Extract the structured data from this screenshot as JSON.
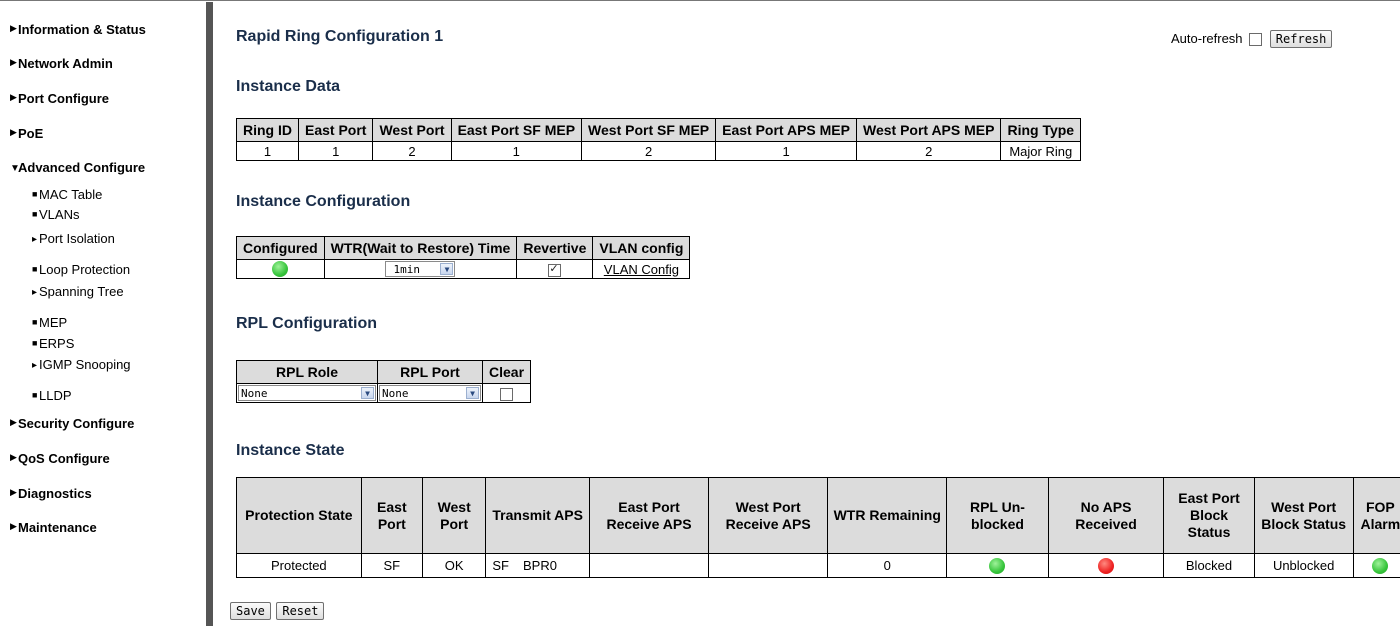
{
  "sidebar": {
    "items": [
      {
        "label": "Information & Status",
        "expanded": false
      },
      {
        "label": "Network Admin",
        "expanded": false
      },
      {
        "label": "Port Configure",
        "expanded": false
      },
      {
        "label": "PoE",
        "expanded": false
      },
      {
        "label": "Advanced Configure",
        "expanded": true
      },
      {
        "label": "Security Configure",
        "expanded": false
      },
      {
        "label": "QoS Configure",
        "expanded": false
      },
      {
        "label": "Diagnostics",
        "expanded": false
      },
      {
        "label": "Maintenance",
        "expanded": false
      }
    ],
    "advanced_children": [
      {
        "label": "MAC Table",
        "type": "leaf"
      },
      {
        "label": "VLANs",
        "type": "leaf"
      },
      {
        "label": "Port Isolation",
        "type": "folder"
      },
      {
        "label": "Loop Protection",
        "type": "leaf"
      },
      {
        "label": "Spanning Tree",
        "type": "folder"
      },
      {
        "label": "MEP",
        "type": "leaf"
      },
      {
        "label": "ERPS",
        "type": "leaf"
      },
      {
        "label": "IGMP Snooping",
        "type": "folder"
      },
      {
        "label": "LLDP",
        "type": "leaf"
      }
    ]
  },
  "page": {
    "title": "Rapid Ring Configuration 1",
    "auto_refresh_label": "Auto-refresh",
    "auto_refresh_checked": false,
    "refresh_button": "Refresh"
  },
  "instance_data": {
    "heading": "Instance Data",
    "headers": [
      "Ring ID",
      "East Port",
      "West Port",
      "East Port SF MEP",
      "West Port SF MEP",
      "East Port APS MEP",
      "West Port APS MEP",
      "Ring Type"
    ],
    "row": [
      "1",
      "1",
      "2",
      "1",
      "2",
      "1",
      "2",
      "Major Ring"
    ]
  },
  "instance_config": {
    "heading": "Instance Configuration",
    "headers": [
      "Configured",
      "WTR(Wait to Restore) Time",
      "Revertive",
      "VLAN config"
    ],
    "configured_status": "green",
    "wtr_value": "1min",
    "revertive_checked": true,
    "vlan_link": "VLAN Config"
  },
  "rpl_config": {
    "heading": "RPL Configuration",
    "headers": [
      "RPL Role",
      "RPL Port",
      "Clear"
    ],
    "rpl_role_value": "None",
    "rpl_port_value": "None",
    "clear_checked": false
  },
  "instance_state": {
    "heading": "Instance State",
    "headers": [
      "Protection State",
      "East Port",
      "West Port",
      "Transmit APS",
      "East Port Receive APS",
      "West Port Receive APS",
      "WTR Remaining",
      "RPL Un-blocked",
      "No APS Received",
      "East Port Block Status",
      "West Port Block Status",
      "FOP Alarm"
    ],
    "row": {
      "protection_state": "Protected",
      "east_port": "SF",
      "west_port": "OK",
      "transmit_aps_a": "SF",
      "transmit_aps_b": "BPR0",
      "east_receive_aps": "",
      "west_receive_aps": "",
      "wtr_remaining": "0",
      "rpl_unblocked": "green",
      "no_aps_received": "red",
      "east_block_status": "Blocked",
      "west_block_status": "Unblocked",
      "fop_alarm": "green"
    }
  },
  "buttons": {
    "save": "Save",
    "reset": "Reset"
  },
  "colors": {
    "heading": "#1a2e4a",
    "header_bg": "#dcdcdc",
    "divider": "#555555",
    "status_green": "#35c43a",
    "status_red": "#ee2222"
  }
}
